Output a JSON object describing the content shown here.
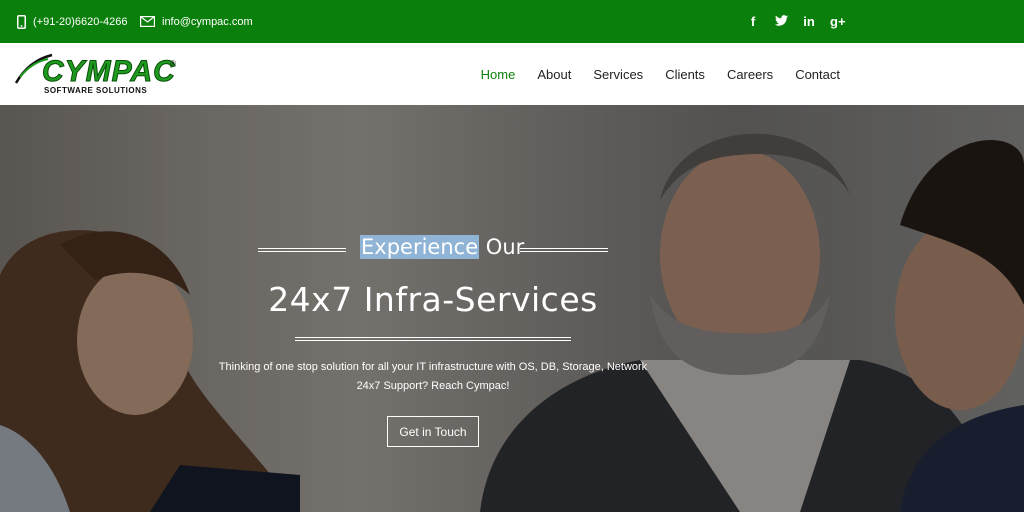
{
  "topbar": {
    "phone": "(+91-20)6620-4266",
    "email": "info@cympac.com",
    "social": [
      {
        "icon": "facebook-icon",
        "glyph": "f"
      },
      {
        "icon": "twitter-icon",
        "glyph": "🐦"
      },
      {
        "icon": "linkedin-icon",
        "glyph": "in"
      },
      {
        "icon": "google-plus-icon",
        "glyph": "g+"
      }
    ],
    "color": "#0b7f0b"
  },
  "brand": {
    "name": "CYMPAC",
    "registered": "®",
    "tagline": "SOFTWARE SOLUTIONS"
  },
  "nav": {
    "items": [
      {
        "label": "Home",
        "active": true
      },
      {
        "label": "About",
        "active": false
      },
      {
        "label": "Services",
        "active": false
      },
      {
        "label": "Clients",
        "active": false
      },
      {
        "label": "Careers",
        "active": false
      },
      {
        "label": "Contact",
        "active": false
      }
    ],
    "active_color": "#0b7f0b"
  },
  "hero": {
    "eyebrow_highlight": "Experience",
    "eyebrow_rest": " Our",
    "headline": "24x7 Infra-Services",
    "subtext_line1": "Thinking of one stop solution for all your IT infrastructure with OS, DB, Storage, Network",
    "subtext_line2": "24x7 Support? Reach Cympac!",
    "cta_label": "Get in Touch"
  }
}
